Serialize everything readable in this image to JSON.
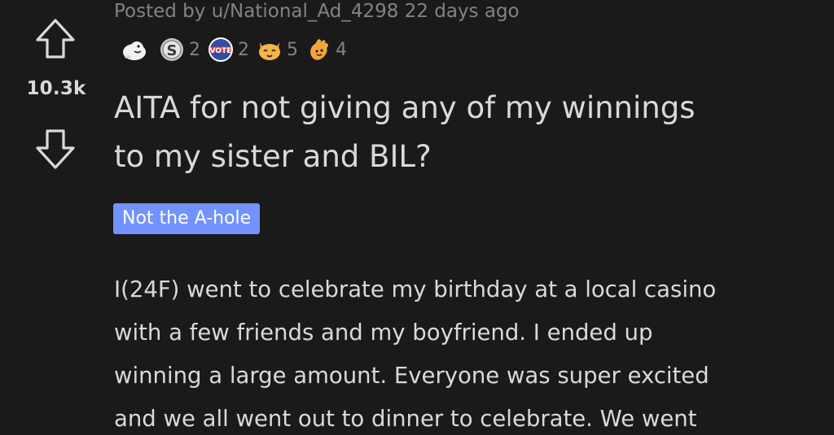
{
  "post": {
    "score": "10.3k",
    "meta": {
      "prefix": "Posted by",
      "author": "u/National_Ad_4298",
      "time": "22 days ago"
    },
    "awards": [
      {
        "icon": "wholesome-seal-icon",
        "count": ""
      },
      {
        "icon": "silver-coin-icon",
        "count": "2"
      },
      {
        "icon": "vote-badge-icon",
        "count": "2"
      },
      {
        "icon": "cat-face-icon",
        "count": "5"
      },
      {
        "icon": "hand-wave-icon",
        "count": "4"
      }
    ],
    "title_lines": [
      "AITA for not giving any of my winnings",
      "to my sister and BIL?"
    ],
    "flair": "Not the A-hole",
    "body_lines": [
      "I(24F) went to celebrate my birthday at a local casino",
      "with a few friends and my boyfriend. I ended up",
      "winning a large amount. Everyone was super excited",
      "and we all went out to dinner to celebrate. We went"
    ]
  },
  "colors": {
    "background": "#1a1a1b",
    "text": "#d7dadc",
    "meta": "#818384",
    "flair_bg": "#7193ff"
  }
}
